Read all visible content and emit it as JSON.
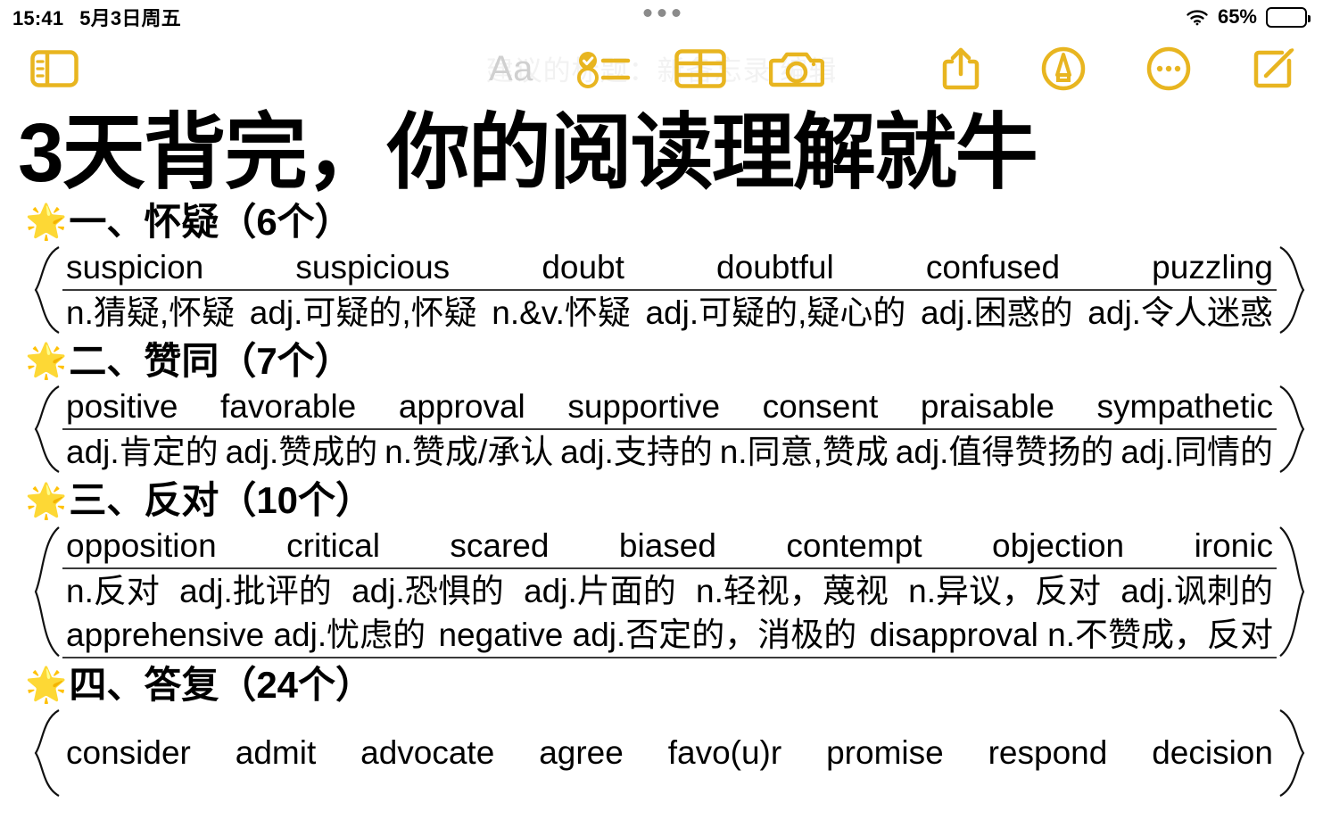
{
  "status_bar": {
    "time": "15:41",
    "date": "5月3日周五",
    "wifi_icon": "wifi-icon",
    "battery_percent": "65%",
    "battery_level": 65
  },
  "toolbar": {
    "sidebar_toggle_icon": "sidebar-toggle-icon",
    "format_label": "Aa",
    "checklist_icon": "checklist-icon",
    "table_icon": "table-icon",
    "camera_icon": "camera-icon",
    "share_icon": "share-icon",
    "markup_icon": "markup-pen-icon",
    "more_icon": "more-ellipsis-icon",
    "compose_icon": "compose-icon",
    "ghost_suggested_title": "建议的标题：新备忘录  编辑",
    "accent_color": "#e8b520"
  },
  "note": {
    "title": "3天背完，你的阅读理解就牛",
    "sections": [
      {
        "star": "🌟",
        "heading": "一、怀疑（6个）",
        "lines": [
          {
            "type": "words",
            "cells": [
              "suspicion",
              "suspicious",
              "doubt",
              "doubtful",
              "confused",
              "puzzling"
            ]
          },
          {
            "type": "meanings",
            "cells": [
              "n.猜疑,怀疑",
              "adj.可疑的,怀疑",
              "n.&v.怀疑",
              "adj.可疑的,疑心的",
              "adj.困惑的",
              "adj.令人迷惑"
            ]
          }
        ]
      },
      {
        "star": "🌟",
        "heading": "二、赞同（7个）",
        "lines": [
          {
            "type": "words",
            "cells": [
              "positive",
              "favorable",
              "approval",
              "supportive",
              "consent",
              "praisable",
              "sympathetic"
            ]
          },
          {
            "type": "meanings",
            "cells": [
              "adj.肯定的",
              "adj.赞成的",
              "n.赞成/承认",
              "adj.支持的",
              "n.同意,赞成",
              "adj.值得赞扬的",
              "adj.同情的"
            ]
          }
        ]
      },
      {
        "star": "🌟",
        "heading": "三、反对（10个）",
        "lines": [
          {
            "type": "words",
            "cells": [
              "opposition",
              "critical",
              "scared",
              "biased",
              "contempt",
              "objection",
              "ironic"
            ]
          },
          {
            "type": "meanings",
            "cells": [
              "n.反对",
              "adj.批评的",
              "adj.恐惧的",
              "adj.片面的",
              "n.轻视，蔑视",
              "n.异议，反对",
              "adj.讽刺的"
            ]
          },
          {
            "type": "meanings_extra",
            "cells": [
              "apprehensive adj.忧虑的",
              "negative adj.否定的，消极的",
              "disapproval n.不赞成，反对"
            ]
          }
        ]
      },
      {
        "star": "🌟",
        "heading": "四、答复（24个）",
        "lines": [
          {
            "type": "words",
            "cells": [
              "consider",
              "admit",
              "advocate",
              "agree",
              "favo(u)r",
              "promise",
              "respond",
              "decision"
            ]
          }
        ]
      }
    ]
  }
}
